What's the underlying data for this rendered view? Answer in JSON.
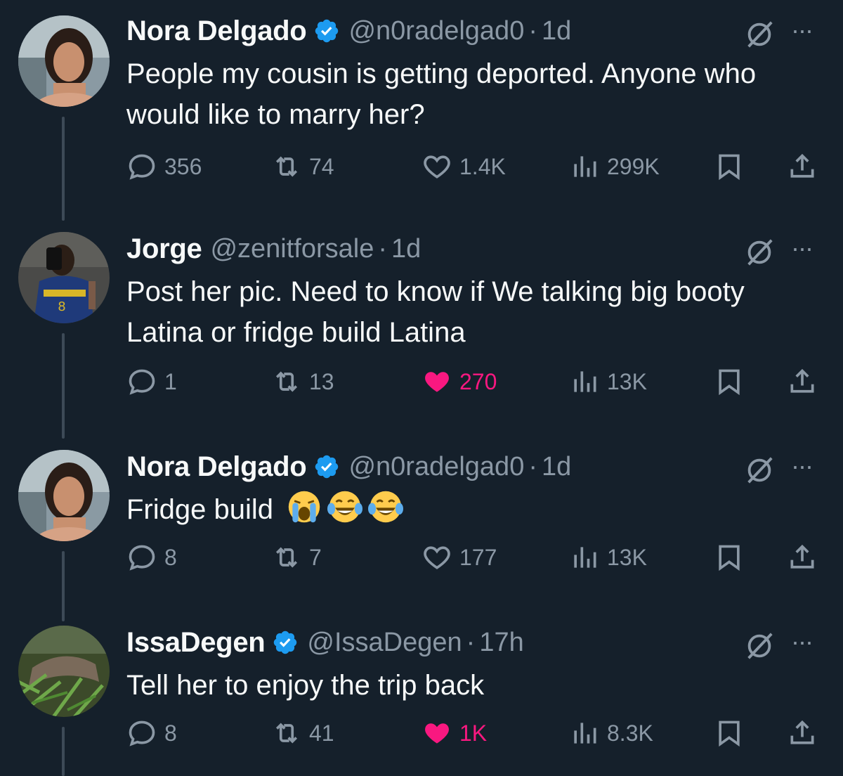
{
  "tweets": [
    {
      "name": "Nora Delgado",
      "verified": true,
      "handle": "@n0radelgad0",
      "time": "1d",
      "text": "People my cousin is getting deported. Anyone who would like to marry her?",
      "replies": "356",
      "reposts": "74",
      "likes": "1.4K",
      "liked": false,
      "views": "299K"
    },
    {
      "name": "Jorge",
      "verified": false,
      "handle": "@zenitforsale",
      "time": "1d",
      "text": "Post her pic. Need to know if We talking big booty Latina or fridge build Latina",
      "replies": "1",
      "reposts": "13",
      "likes": "270",
      "liked": true,
      "views": "13K"
    },
    {
      "name": "Nora Delgado",
      "verified": true,
      "handle": "@n0radelgad0",
      "time": "1d",
      "text": "Fridge build",
      "emojis": [
        "loudly-crying-face",
        "tears-of-joy-face",
        "tears-of-joy-face"
      ],
      "replies": "8",
      "reposts": "7",
      "likes": "177",
      "liked": false,
      "views": "13K"
    },
    {
      "name": "IssaDegen",
      "verified": true,
      "handle": "@IssaDegen",
      "time": "17h",
      "text": "Tell her to enjoy the trip back",
      "replies": "8",
      "reposts": "41",
      "likes": "1K",
      "liked": true,
      "views": "8.3K"
    }
  ],
  "ui": {
    "dot": "·",
    "more": "···"
  },
  "colors": {
    "background": "#15202b",
    "muted": "#8b98a5",
    "like": "#f91880",
    "verified": "#1d9bf0"
  }
}
